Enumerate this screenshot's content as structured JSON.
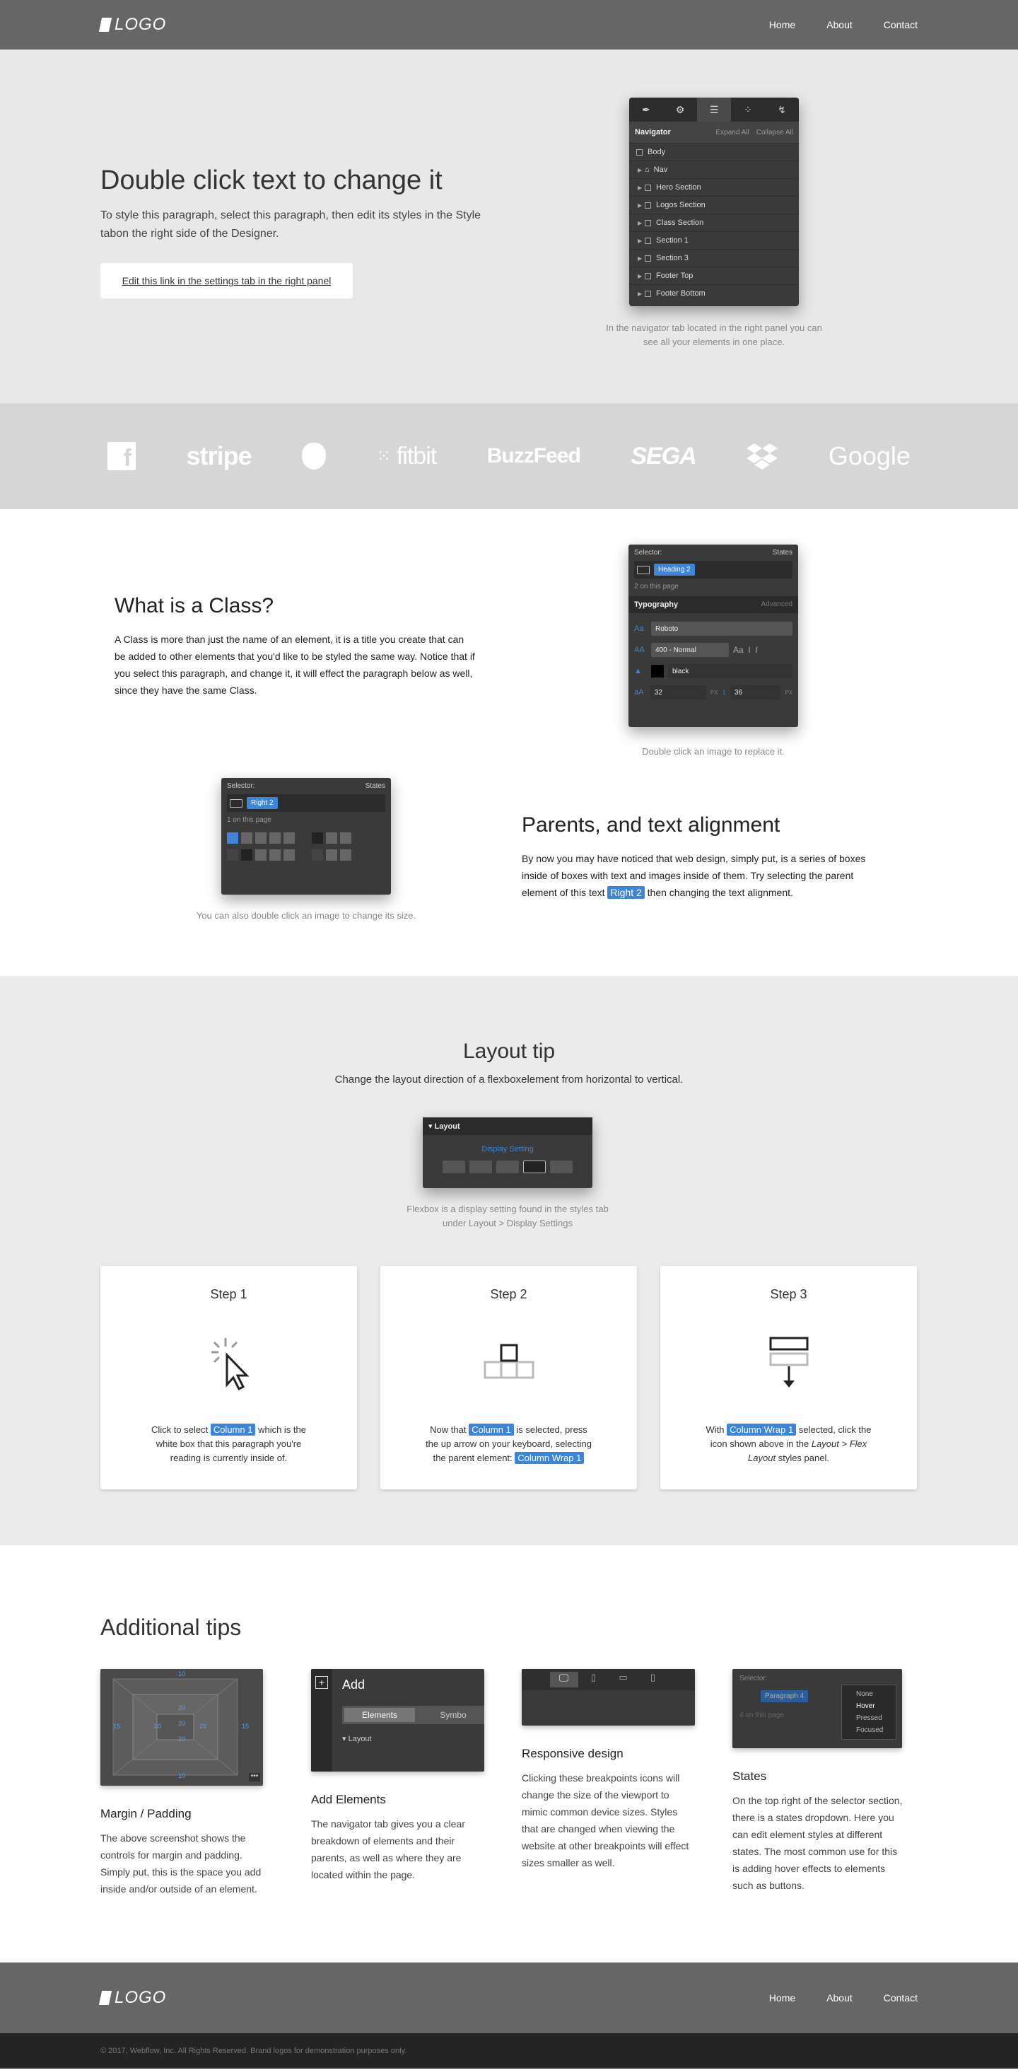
{
  "nav": {
    "logo": "LOGO",
    "links": [
      "Home",
      "About",
      "Contact"
    ]
  },
  "hero": {
    "title": "Double click text to change it",
    "subtitle": "To style this paragraph, select this paragraph, then edit its styles in the Style tabon the right side of the Designer.",
    "button": "Edit this link in the settings tab in the right panel",
    "navigator": {
      "title": "Navigator",
      "expand": "Expand All",
      "collapse": "Collapse All",
      "items": [
        "Body",
        "Nav",
        "Hero Section",
        "Logos Section",
        "Class Section",
        "Section 1",
        "Section 3",
        "Footer Top",
        "Footer Bottom"
      ]
    },
    "caption": "In the navigator tab located in the right panel you can see all your elements in one place."
  },
  "logos": [
    "stripe",
    "fitbit",
    "BuzzFeed",
    "SEGA",
    "Google"
  ],
  "class_section": {
    "title": "What is a Class?",
    "body": "A Class is more than just the name of an element, it is a title you create that can be added to other elements that you'd like to be styled the same way. Notice that if you select this paragraph, and change it, it will effect the paragraph below as well, since they have the same Class.",
    "panel": {
      "selector": "Selector:",
      "states": "States",
      "chip": "Heading 2",
      "count": "2 on this page",
      "typography": "Typography",
      "advanced": "Advanced",
      "font": "Roboto",
      "weight": "400 - Normal",
      "color": "black",
      "size": "32",
      "size_unit": "PX",
      "line_height": "36",
      "line_unit": "PX"
    },
    "caption": "Double click an image to replace it.",
    "panel2": {
      "selector": "Selector:",
      "states": "States",
      "chip": "Right 2",
      "count": "1 on this page"
    },
    "caption2": "You can also double click an image to change its size.",
    "title2": "Parents, and text alignment",
    "body2_a": "By now you may have noticed that web design, simply put, is a series of boxes inside of boxes with text and images inside of them. Try selecting the parent element of this text",
    "body2_chip": "Right 2",
    "body2_b": "then changing the text alignment."
  },
  "layout_tip": {
    "title": "Layout tip",
    "lead": "Change the layout direction of a flexboxelement from horizontal to vertical.",
    "panel_title": "Layout",
    "panel_label": "Display Setting",
    "caption": "Flexbox is a display setting found in the styles tab under Layout > Display Settings",
    "steps": [
      {
        "title": "Step 1",
        "pre": "Click to select",
        "chip": "Column 1",
        "post": "which is the white box that this paragraph you're reading is currently inside of."
      },
      {
        "title": "Step 2",
        "pre": "Now that",
        "chip": "Column 1",
        "mid": "is selected, press the up arrow on your keyboard, selecting the parent element:",
        "chip2": "Column Wrap 1"
      },
      {
        "title": "Step 3",
        "pre": "With",
        "chip": "Column Wrap 1",
        "mid": "selected, click the icon shown above in the",
        "em": "Layout > Flex Layout",
        "post": "styles panel."
      }
    ]
  },
  "additional": {
    "title": "Additional tips",
    "cards": [
      {
        "title": "Margin / Padding",
        "body": "The above screenshot shows the controls for margin and padding. Simply put, this is the space you add inside and/or outside of an element."
      },
      {
        "title": "Add Elements",
        "body": "The navigator tab gives you a clear breakdown of elements and their parents, as well as where they are located within the page."
      },
      {
        "title": "Responsive design",
        "body": "Clicking these breakpoints icons will change the size of the viewport to mimic common device sizes. Styles that are changed when viewing the website at other breakpoints will effect sizes smaller as well."
      },
      {
        "title": "States",
        "body": "On the top right of the selector section, there is a states dropdown. Here you can edit element styles at different states. The most common use for this is adding hover effects to elements such as buttons."
      }
    ],
    "margin_values": [
      "10",
      "15",
      "20",
      "20",
      "20",
      "20",
      "15",
      "10",
      "20"
    ],
    "add_panel": {
      "title": "Add",
      "tab1": "Elements",
      "tab2": "Symbo",
      "section": "Layout"
    },
    "states_menu": [
      "None",
      "Hover",
      "Pressed",
      "Focused"
    ],
    "states_panel": {
      "selector": "Selector:",
      "chip": "Paragraph 4",
      "count": "4 on this page"
    }
  },
  "footer": {
    "logo": "LOGO",
    "links": [
      "Home",
      "About",
      "Contact"
    ],
    "copyright": "© 2017, Webflow, Inc. All Rights Reserved. Brand logos for demonstration purposes only."
  }
}
